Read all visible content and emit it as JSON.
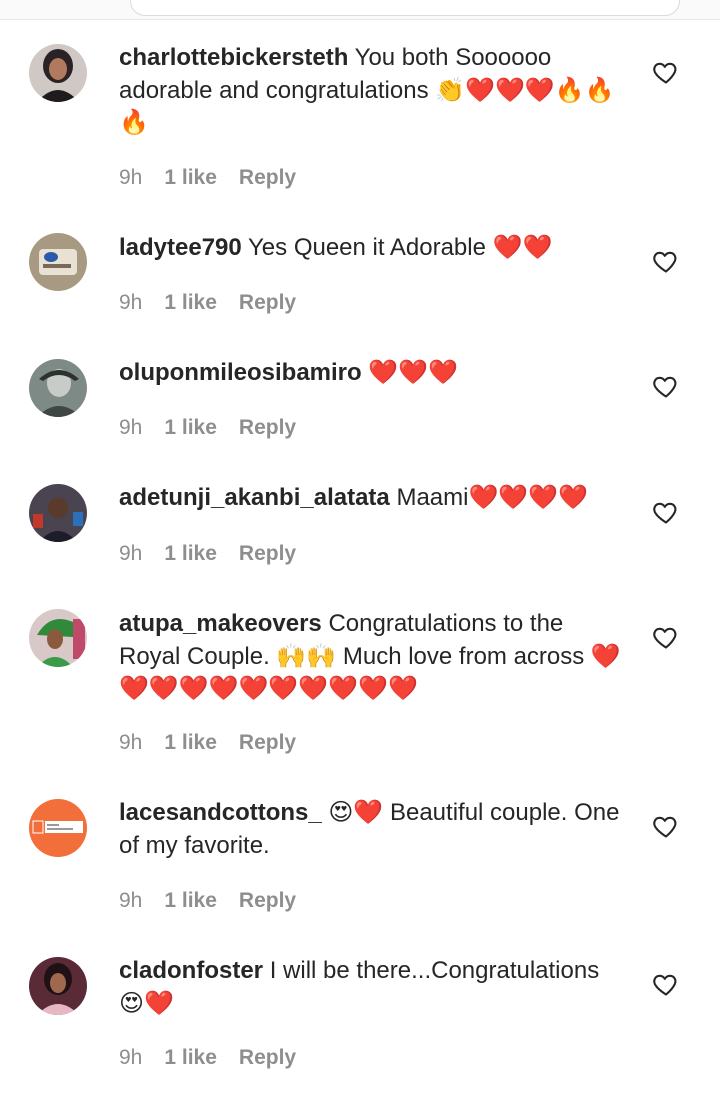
{
  "comments": [
    {
      "username": "charlottebickersteth",
      "text": "You both Soooooo adorable and congratulations 👏❤️❤️❤️🔥🔥🔥",
      "time": "9h",
      "likes": "1 like",
      "reply": "Reply",
      "avatar_icon": "woman-portrait",
      "avatar_color": "#2e2a2c"
    },
    {
      "username": "ladytee790",
      "text": "Yes Queen it Adorable ❤️❤️",
      "time": "9h",
      "likes": "1 like",
      "reply": "Reply",
      "avatar_icon": "product-box",
      "avatar_color": "#b7a98f"
    },
    {
      "username": "oluponmileosibamiro",
      "text": "❤️❤️❤️",
      "time": "9h",
      "likes": "1 like",
      "reply": "Reply",
      "avatar_icon": "vintage-portrait",
      "avatar_color": "#5d6a66"
    },
    {
      "username": "adetunji_akanbi_alatata",
      "text": "Maami❤️❤️❤️❤️",
      "time": "9h",
      "likes": "1 like",
      "reply": "Reply",
      "avatar_icon": "press-crowd",
      "avatar_color": "#3b3540"
    },
    {
      "username": "atupa_makeovers",
      "text": "Congratulations to the Royal Couple. 🙌🙌 Much love from across ❤️❤️❤️❤️❤️❤️❤️❤️❤️❤️❤️",
      "time": "9h",
      "likes": "1 like",
      "reply": "Reply",
      "avatar_icon": "woman-green-gele",
      "avatar_color": "#2f7a3c"
    },
    {
      "username": "lacesandcottons_",
      "text": "😍❤️ Beautiful couple. One of my favorite.",
      "time": "9h",
      "likes": "1 like",
      "reply": "Reply",
      "avatar_icon": "brand-logo",
      "avatar_color": "#f26e3a"
    },
    {
      "username": "cladonfoster",
      "text": "I will be there...Congratulations 😍❤️",
      "time": "9h",
      "likes": "1 like",
      "reply": "Reply",
      "avatar_icon": "woman-portrait",
      "avatar_color": "#3a1f2a"
    }
  ],
  "ui": {
    "heart_icon": "heart-outline-icon",
    "meta_color": "#8e8e8e",
    "text_color": "#262626"
  }
}
